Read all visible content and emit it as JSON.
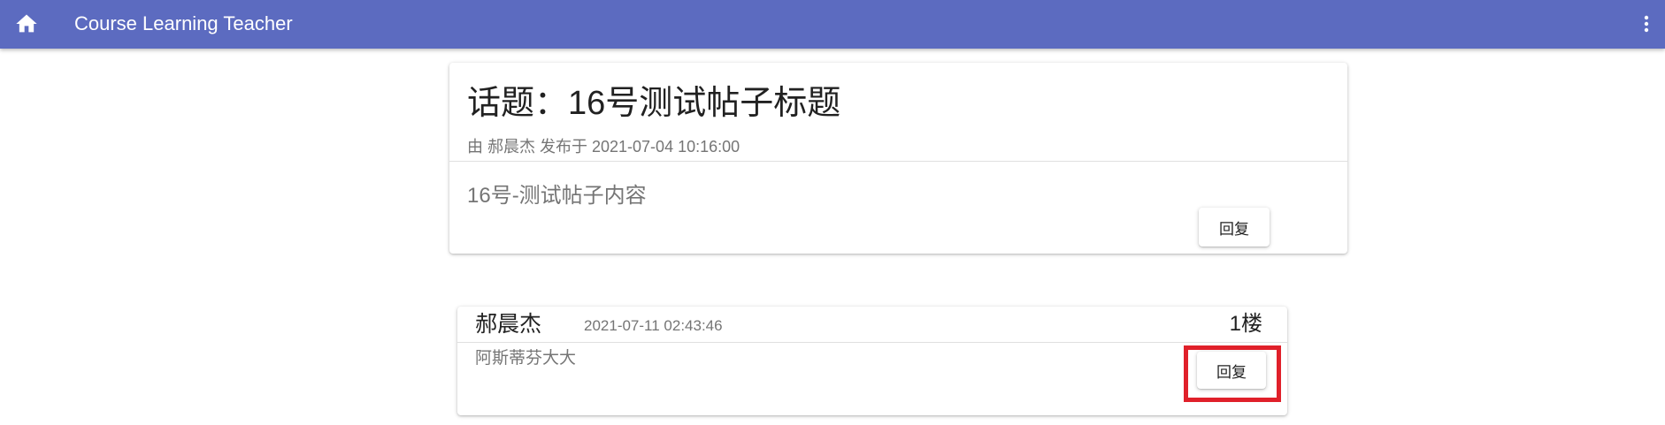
{
  "app": {
    "title": "Course Learning Teacher",
    "brand_color": "#5c6bc0",
    "home_icon": "home-icon",
    "menu_icon": "more-vertical-icon"
  },
  "topic": {
    "title": "话题：16号测试帖子标题",
    "meta": "由 郝晨杰 发布于 2021-07-04 10:16:00",
    "content": "16号-测试帖子内容",
    "reply_label": "回复"
  },
  "replies": [
    {
      "author": "郝晨杰",
      "time": "2021-07-11 02:43:46",
      "floor": "1楼",
      "content": "阿斯蒂芬大大",
      "reply_label": "回复",
      "highlight_color": "#e0202a"
    }
  ]
}
